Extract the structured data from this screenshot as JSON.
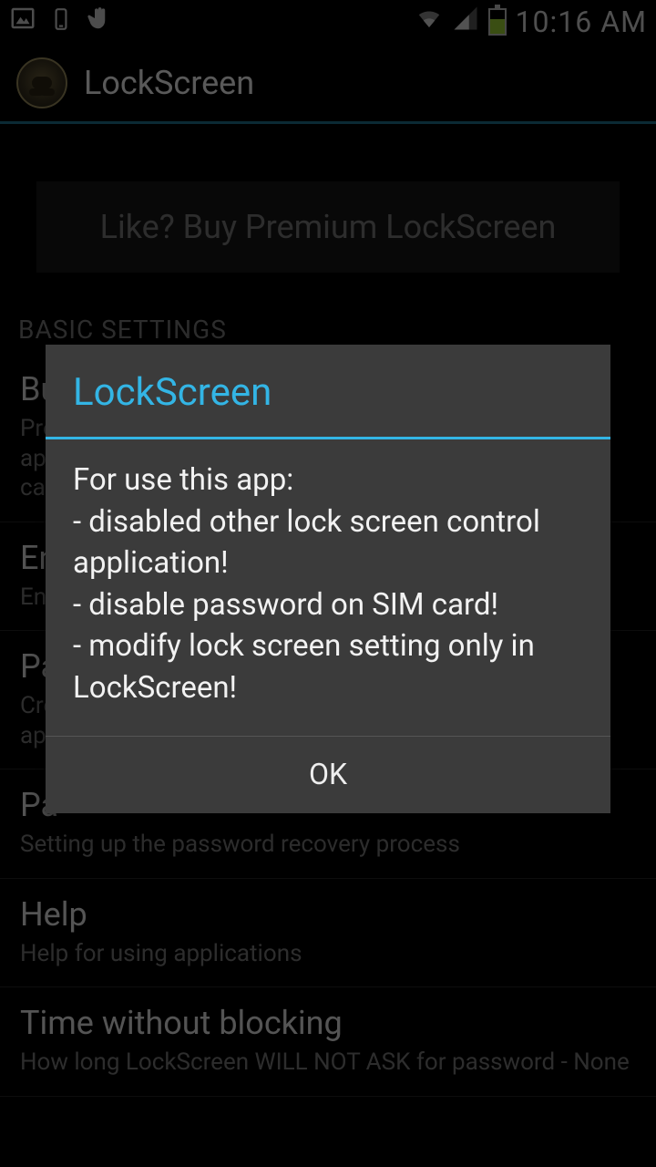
{
  "status": {
    "time": "10:16 AM"
  },
  "actionbar": {
    "title": "LockScreen"
  },
  "promo": {
    "text": "Like? Buy Premium LockScreen"
  },
  "section_header": "BASIC SETTINGS",
  "prefs": [
    {
      "title": "Bu",
      "summary": "Pre\nap\nca"
    },
    {
      "title": "En",
      "summary": "En"
    },
    {
      "title": "Pa",
      "summary": "Cre\nap"
    },
    {
      "title": "Pa",
      "summary": "Setting up the password recovery process"
    },
    {
      "title": "Help",
      "summary": "Help for using applications"
    },
    {
      "title": "Time without blocking",
      "summary": "How long LockScreen WILL NOT ASK for password - None"
    }
  ],
  "dialog": {
    "title": "LockScreen",
    "body": "For use this app:\n- disabled other lock screen control application!\n- disable password on SIM card!\n- modify lock screen setting only in LockScreen!",
    "ok": "OK"
  }
}
